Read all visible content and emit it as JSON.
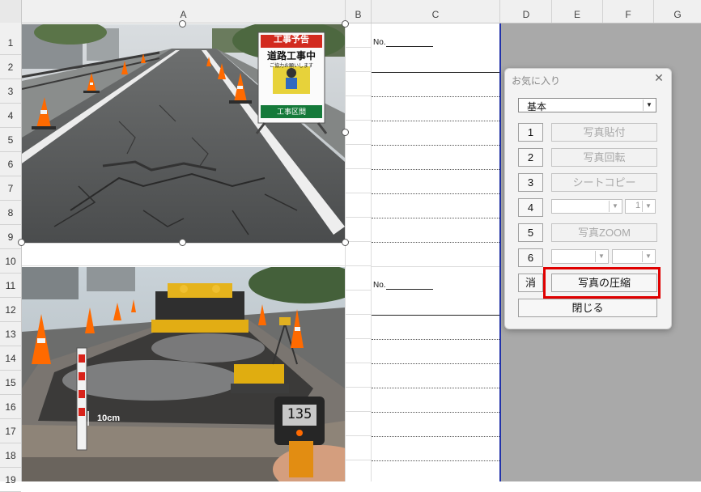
{
  "sheet": {
    "columns": [
      "A",
      "B",
      "C",
      "D",
      "E",
      "F",
      "G"
    ],
    "rows": [
      "1",
      "2",
      "3",
      "4",
      "5",
      "6",
      "7",
      "8",
      "9",
      "10",
      "11",
      "12",
      "13",
      "14",
      "15",
      "16",
      "17",
      "18",
      "19"
    ],
    "no_label_1": "No.",
    "no_label_2": "No."
  },
  "photo1": {
    "sign_title": "工事予告",
    "sign_main": "道路工事中",
    "sign_sub": "ご協力お願いします",
    "sign_bottom": "工事区間"
  },
  "photo2": {
    "gauge_label": "10cm",
    "thermometer_reading": "135"
  },
  "dialog": {
    "title": "お気に入り",
    "close_glyph": "✕",
    "preset_value": "基本",
    "buttons": [
      {
        "num": "1",
        "label": "写真貼付"
      },
      {
        "num": "2",
        "label": "写真回転"
      },
      {
        "num": "3",
        "label": "シートコピー"
      },
      {
        "num": "4",
        "label": ""
      },
      {
        "num": "5",
        "label": "写真ZOOM"
      },
      {
        "num": "6",
        "label": ""
      }
    ],
    "row4_combo2_value": "1",
    "erase_label": "消",
    "compress_label": "写真の圧縮",
    "close_label": "閉じる"
  },
  "colors": {
    "highlight": "#e00000",
    "print_border": "#2233aa",
    "grey_area": "#a9a9a9"
  }
}
